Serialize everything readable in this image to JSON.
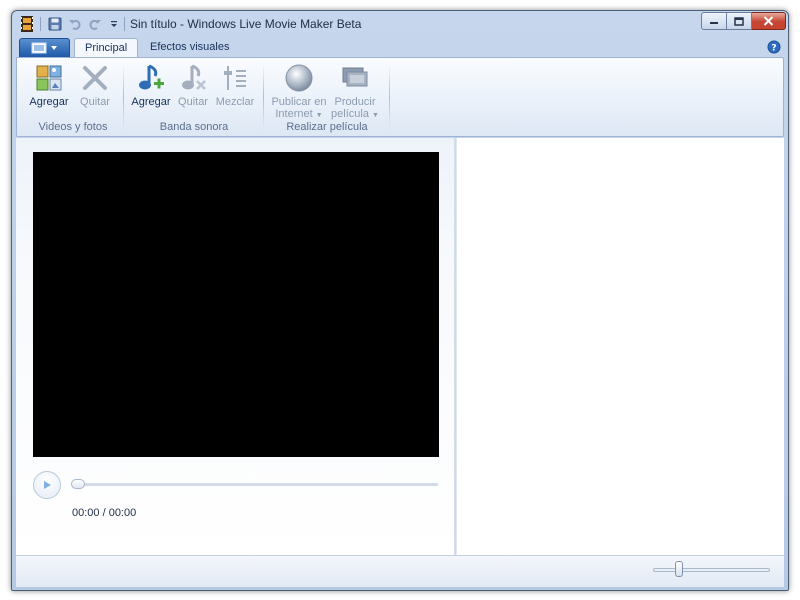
{
  "window": {
    "title": "Sin título - Windows Live Movie Maker Beta"
  },
  "quick_access": {
    "icons": [
      "film-icon",
      "save-icon",
      "undo-icon",
      "redo-icon",
      "customize-dropdown-icon"
    ]
  },
  "window_controls": {
    "icons": [
      "minimize-icon",
      "maximize-icon",
      "close-icon"
    ]
  },
  "tabs": [
    {
      "label": "Principal",
      "active": true
    },
    {
      "label": "Efectos visuales",
      "active": false
    }
  ],
  "ribbon": {
    "groups": [
      {
        "label": "Videos y fotos",
        "buttons": [
          {
            "label": "Agregar",
            "icon": "add-media-icon",
            "enabled": true
          },
          {
            "label": "Quitar",
            "icon": "remove-x-icon",
            "enabled": false
          }
        ]
      },
      {
        "label": "Banda sonora",
        "buttons": [
          {
            "label": "Agregar",
            "icon": "add-music-icon",
            "enabled": true
          },
          {
            "label": "Quitar",
            "icon": "remove-music-icon",
            "enabled": false
          },
          {
            "label": "Mezclar",
            "icon": "mix-audio-icon",
            "enabled": false
          }
        ]
      },
      {
        "label": "Realizar película",
        "buttons": [
          {
            "label_line1": "Publicar en",
            "label_line2": "Internet",
            "icon": "globe-icon",
            "enabled": false,
            "dropdown": true
          },
          {
            "label_line1": "Producir",
            "label_line2": "película",
            "icon": "produce-movie-icon",
            "enabled": false,
            "dropdown": true
          }
        ]
      }
    ]
  },
  "player": {
    "timecode": "00:00 / 00:00",
    "progress": 0
  },
  "statusbar": {
    "zoom_level_fraction": 0.2
  },
  "colors": {
    "accent": "#1e5aa8",
    "chrome": "#c6d6ec",
    "video_background": "#000000",
    "close_button": "#c54532"
  }
}
